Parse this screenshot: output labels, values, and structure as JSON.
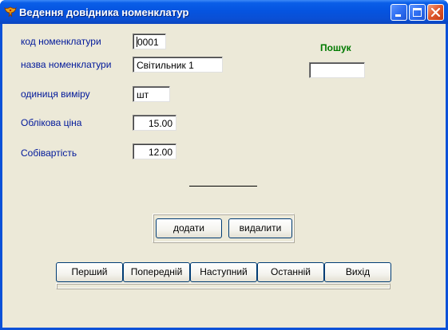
{
  "window": {
    "title": "Ведення довідника номенклатур"
  },
  "form": {
    "code_label": "код номенклатури",
    "code_value": "0001",
    "name_label": "назва номенклатури",
    "name_value": "Світильник 1",
    "unit_label": "одиниця виміру",
    "unit_value": "шт",
    "price_label": "Облікова ціна",
    "price_value": "15.00",
    "cost_label": "Собівартість",
    "cost_value": "12.00"
  },
  "search": {
    "label": "Пошук",
    "value": ""
  },
  "actions": {
    "add": "додати",
    "delete": "видалити"
  },
  "nav": {
    "first": "Перший",
    "prev": "Попередній",
    "next": "Наступний",
    "last": "Останній",
    "exit": "Вихід"
  }
}
